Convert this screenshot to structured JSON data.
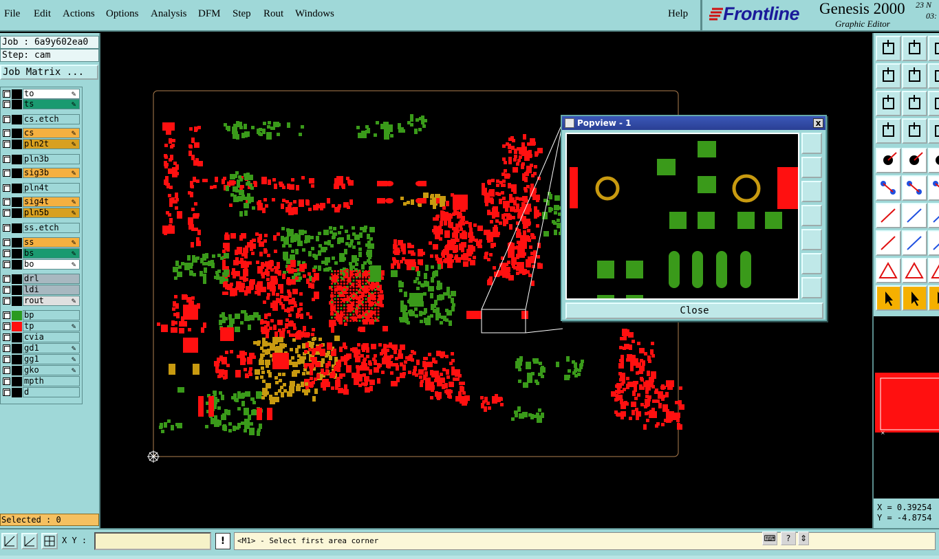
{
  "menu": {
    "items": [
      {
        "label": "File"
      },
      {
        "label": "Edit"
      },
      {
        "label": "Actions"
      },
      {
        "label": "Options"
      },
      {
        "label": "Analysis"
      },
      {
        "label": "DFM"
      },
      {
        "label": "Step"
      },
      {
        "label": "Rout"
      },
      {
        "label": "Windows"
      }
    ],
    "help": "Help"
  },
  "brand": {
    "logo": "Frontline",
    "product": "Genesis 2000",
    "subtitle": "Graphic Editor",
    "date_line1": "23 N",
    "date_line2": "03:"
  },
  "job": {
    "job_label": "Job : 6a9y602ea0",
    "step_label": "Step: cam",
    "matrix_button": "Job Matrix ..."
  },
  "layers": [
    {
      "name": "to",
      "color": "#ffffff",
      "edit": true
    },
    {
      "name": "ts",
      "color": "#1a9a70",
      "edit": true
    },
    {
      "name": "cs.etch",
      "color": "#9fd8d8",
      "edit": false
    },
    {
      "name": "cs",
      "color": "#f5b040",
      "edit": true
    },
    {
      "name": "pln2t",
      "color": "#d8a020",
      "edit": true
    },
    {
      "name": "pln3b",
      "color": "#9fd8d8",
      "edit": false
    },
    {
      "name": "sig3b",
      "color": "#f5b040",
      "edit": true
    },
    {
      "name": "pln4t",
      "color": "#9fd8d8",
      "edit": false
    },
    {
      "name": "sig4t",
      "color": "#f5b040",
      "edit": true
    },
    {
      "name": "pln5b",
      "color": "#d8a020",
      "edit": true
    },
    {
      "name": "ss.etch",
      "color": "#9fd8d8",
      "edit": false
    },
    {
      "name": "ss",
      "color": "#f5b040",
      "edit": true
    },
    {
      "name": "bs",
      "color": "#1a9a70",
      "edit": true
    },
    {
      "name": "bo",
      "color": "#ffffff",
      "edit": true
    },
    {
      "name": "drl",
      "color": "#a8b8c0",
      "edit": false
    },
    {
      "name": "ldi",
      "color": "#a8b8c0",
      "edit": false
    },
    {
      "name": "rout",
      "color": "#e0e0e0",
      "edit": true
    },
    {
      "name": "bp",
      "color": "#9fd8d8",
      "edit": false
    },
    {
      "name": "tp",
      "color": "#9fd8d8",
      "edit": true
    },
    {
      "name": "cvia",
      "color": "#9fd8d8",
      "edit": false
    },
    {
      "name": "gd1",
      "color": "#9fd8d8",
      "edit": true
    },
    {
      "name": "gg1",
      "color": "#9fd8d8",
      "edit": true
    },
    {
      "name": "gko",
      "color": "#9fd8d8",
      "edit": true
    },
    {
      "name": "mpth",
      "color": "#9fd8d8",
      "edit": false
    },
    {
      "name": "d",
      "color": "#9fd8d8",
      "edit": false
    }
  ],
  "selected": "Selected : 0",
  "popview": {
    "title": "Popview - 1",
    "close_x": "x",
    "close_button": "Close"
  },
  "coords": {
    "x": "X = 0.39254",
    "y": "Y = -4.8754"
  },
  "bottom": {
    "xy_label": "X Y :",
    "xy_value": "",
    "message_icon": "!",
    "message": "<M1> - Select first area corner"
  },
  "colors": {
    "panel": "#9fd8d8",
    "copper_red": "#ff1010",
    "copper_green": "#3a9a1a",
    "pad_gold": "#c89a10",
    "outline": "#b08050"
  }
}
